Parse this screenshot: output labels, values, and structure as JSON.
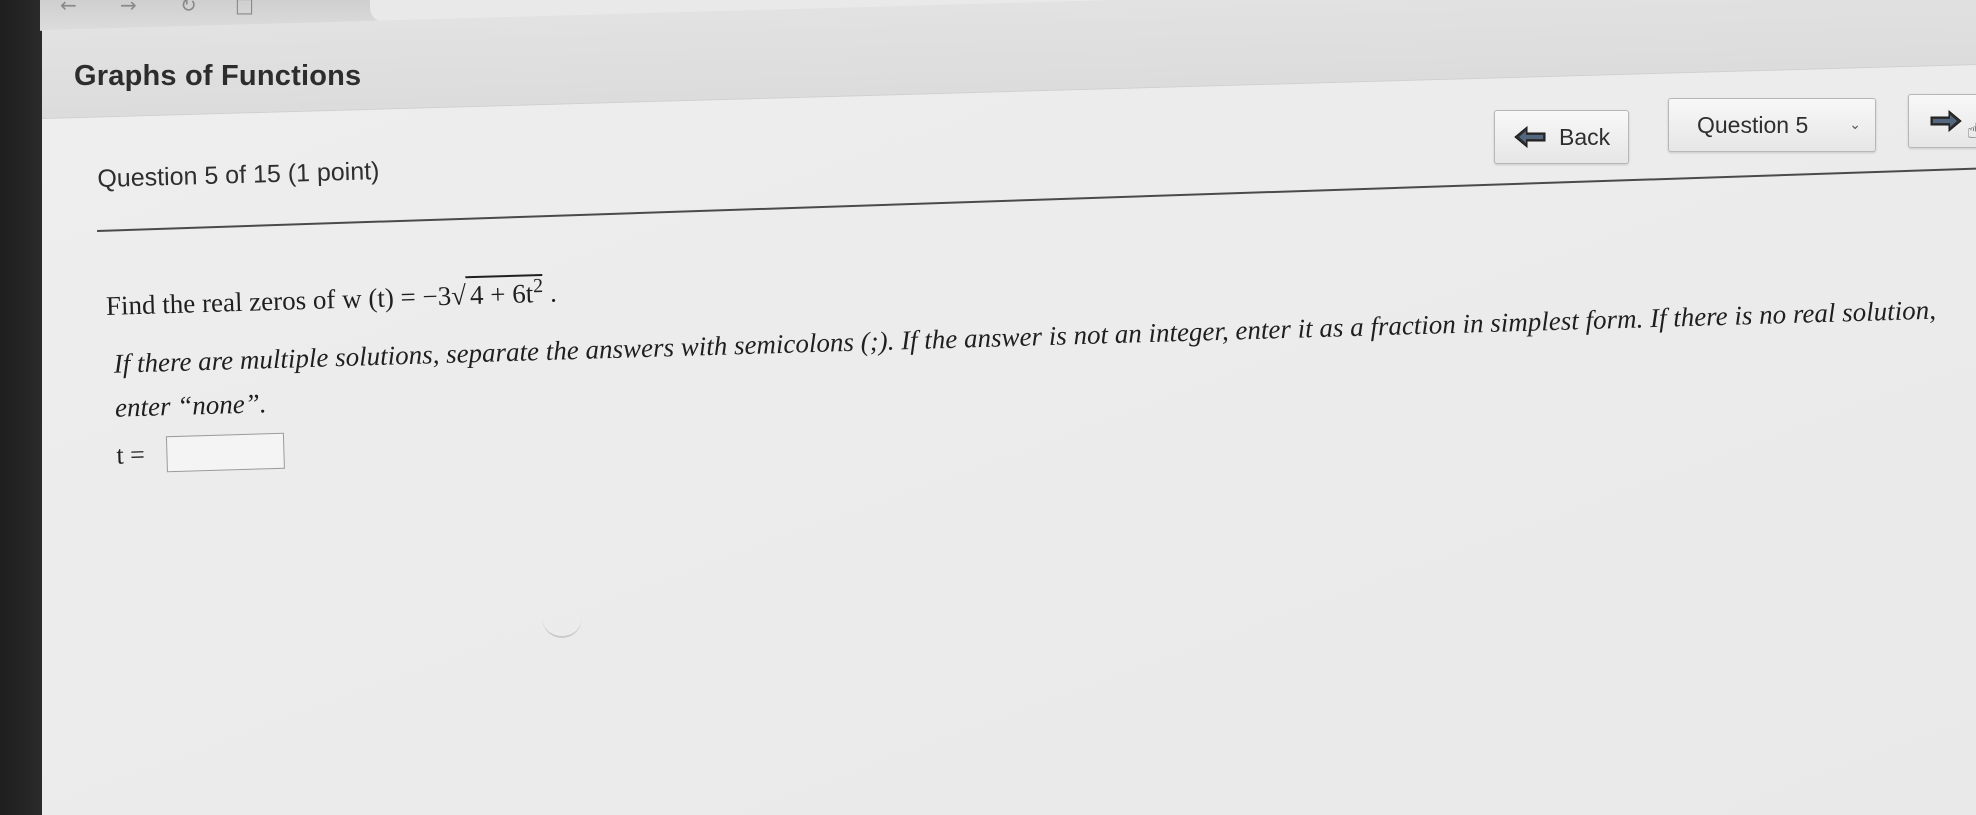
{
  "browser": {
    "back_glyph": "←",
    "forward_glyph": "→",
    "reload_glyph": "↻",
    "share_glyph": "□"
  },
  "header": {
    "title": "Graphs of Functions"
  },
  "question_meta": {
    "progress": "Question 5 of 15 (1 point)"
  },
  "nav": {
    "back_label": "Back",
    "question_select": {
      "selected": "Question 5",
      "chevron": "⌄"
    },
    "next_icon": "arrow-right-icon",
    "cursor_glyph": "☝"
  },
  "problem": {
    "prompt_prefix": "Find the real zeros of w (t) = −3√",
    "radicand": "4 + 6t",
    "exponent": "2",
    "prompt_suffix": ".",
    "instructions": "If there are multiple solutions, separate the answers with semicolons (;). If the answer is not an integer, enter it as a fraction in simplest form. If there is no real solution, enter “none”.",
    "answer_label": "t =",
    "answer_value": ""
  },
  "colors": {
    "page_bg": "#ececec",
    "header_bg": "#dedede",
    "text": "#1f1f1f",
    "button_arrow": "#2f2f2f"
  }
}
